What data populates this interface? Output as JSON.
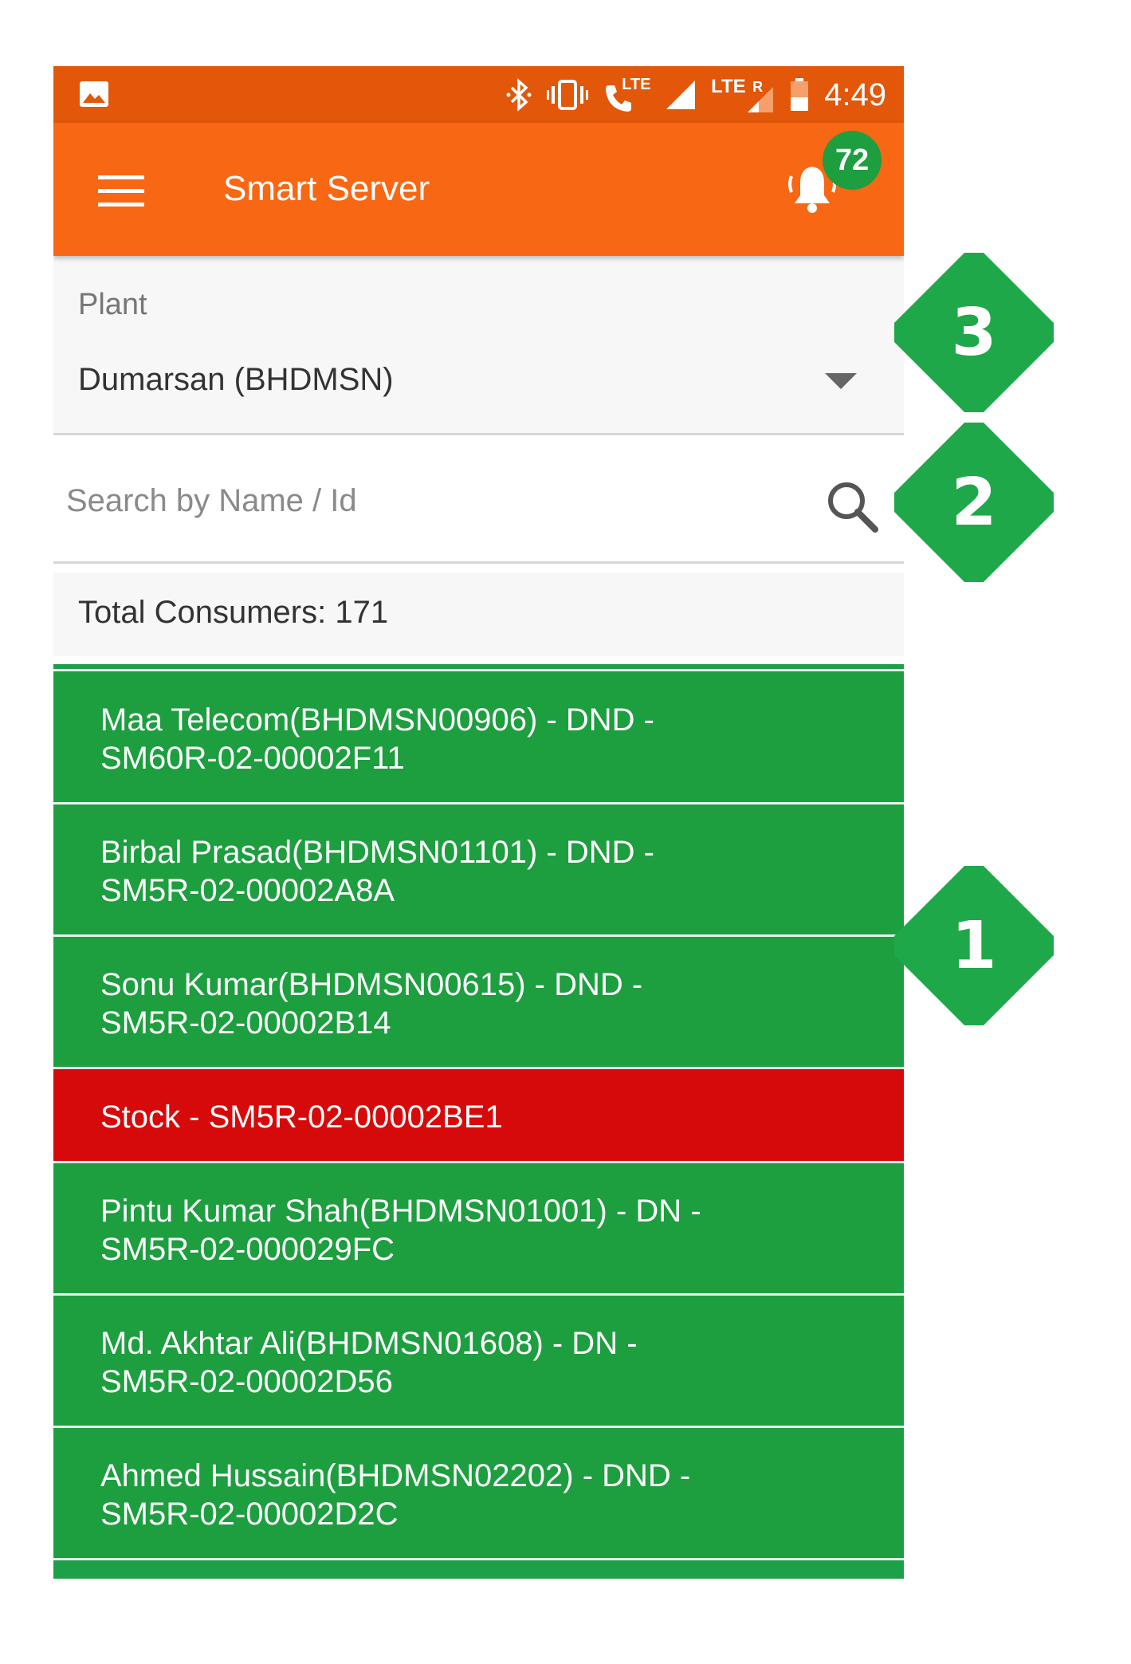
{
  "status_bar": {
    "time": "4:49",
    "network_labels": [
      "LTE",
      "LTE",
      "R"
    ],
    "icons": [
      "image-icon",
      "bluetooth-icon",
      "vibrate-icon",
      "volte-call-icon",
      "signal-icon",
      "signal-roaming-icon",
      "battery-icon"
    ]
  },
  "app_bar": {
    "title": "Smart Server",
    "notification_count": "72",
    "accent": "#f86714",
    "status_color": "#e2570a"
  },
  "plant": {
    "label": "Plant",
    "value": "Dumarsan (BHDMSN)"
  },
  "search": {
    "placeholder": "Search by Name / Id",
    "value": ""
  },
  "total": {
    "text": "Total Consumers: 171"
  },
  "list": {
    "items": [
      {
        "line1": "Maa Telecom(BHDMSN00906) - DND -",
        "line2": "SM60R-02-00002F11",
        "status": "green"
      },
      {
        "line1": "Birbal Prasad(BHDMSN01101) - DND -",
        "line2": "SM5R-02-00002A8A",
        "status": "green"
      },
      {
        "line1": "Sonu Kumar(BHDMSN00615) - DND -",
        "line2": "SM5R-02-00002B14",
        "status": "green"
      },
      {
        "line1": "Stock - SM5R-02-00002BE1",
        "line2": "",
        "status": "red"
      },
      {
        "line1": "Pintu Kumar Shah(BHDMSN01001) - DN -",
        "line2": "SM5R-02-000029FC",
        "status": "green"
      },
      {
        "line1": "Md. Akhtar Ali(BHDMSN01608) - DN -",
        "line2": "SM5R-02-00002D56",
        "status": "green"
      },
      {
        "line1": "Ahmed Hussain(BHDMSN02202) - DND -",
        "line2": "SM5R-02-00002D2C",
        "status": "green"
      }
    ],
    "colors": {
      "green": "#1d9e3f",
      "red": "#d60a0a"
    }
  },
  "callouts": [
    "3",
    "2",
    "1"
  ],
  "callout_color": "#1fa84a"
}
